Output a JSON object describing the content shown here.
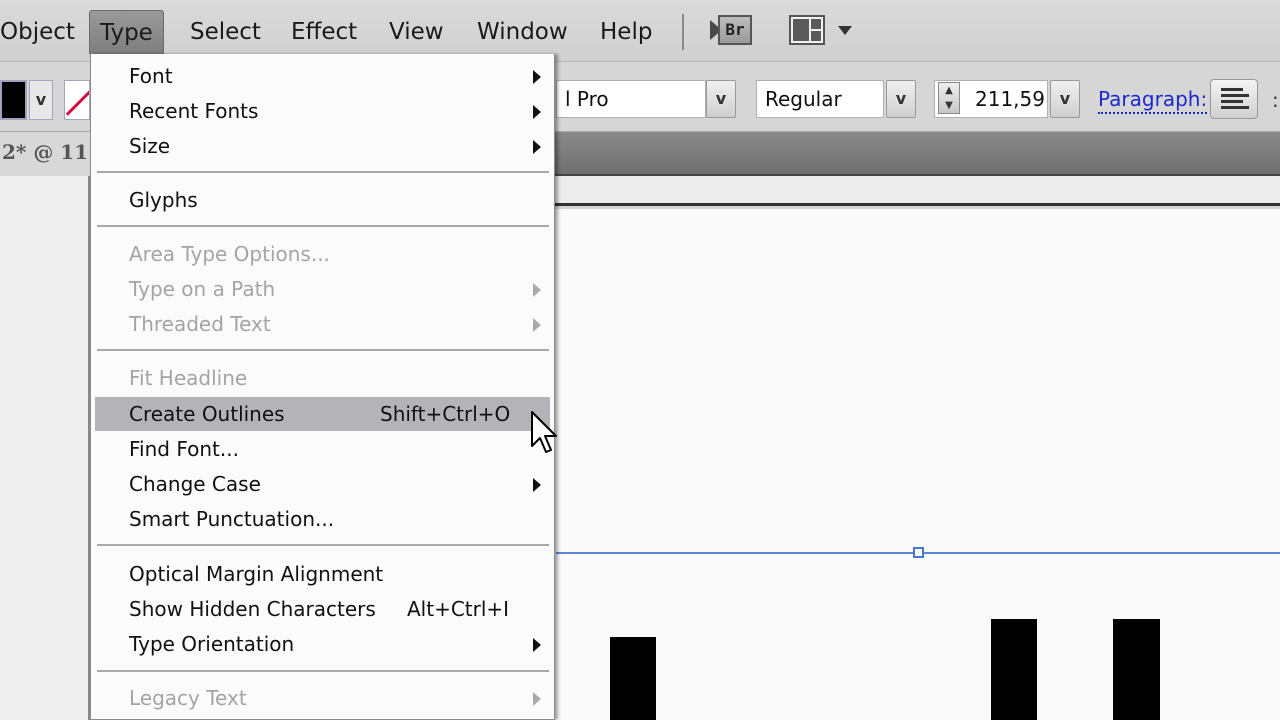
{
  "menubar": {
    "items": [
      {
        "label": "Object"
      },
      {
        "label": "Type",
        "active": true
      },
      {
        "label": "Select"
      },
      {
        "label": "Effect"
      },
      {
        "label": "View"
      },
      {
        "label": "Window"
      },
      {
        "label": "Help"
      }
    ],
    "bridge_icon_label": "Br",
    "icons": [
      "bridge-icon",
      "workspace-switcher-icon",
      "caret-down-icon"
    ]
  },
  "controlbar": {
    "fill_color": "#000000",
    "stroke_color": "none",
    "font_family_value": "l Pro",
    "font_style_value": "Regular",
    "font_size_value": "211,59",
    "paragraph_label": "Paragraph:",
    "chevron": "v"
  },
  "document": {
    "tab_label": "2* @ 11"
  },
  "type_menu": {
    "items": [
      {
        "label": "Font",
        "submenu": true,
        "enabled": true
      },
      {
        "label": "Recent Fonts",
        "submenu": true,
        "enabled": true
      },
      {
        "label": "Size",
        "submenu": true,
        "enabled": true
      },
      {
        "separator": true
      },
      {
        "label": "Glyphs",
        "enabled": true
      },
      {
        "separator": true
      },
      {
        "label": "Area Type Options...",
        "enabled": false
      },
      {
        "label": "Type on a Path",
        "submenu": true,
        "enabled": false
      },
      {
        "label": "Threaded Text",
        "submenu": true,
        "enabled": false
      },
      {
        "separator": true
      },
      {
        "label": "Fit Headline",
        "enabled": false
      },
      {
        "label": "Create Outlines",
        "shortcut": "Shift+Ctrl+O",
        "enabled": true,
        "highlighted": true
      },
      {
        "label": "Find Font...",
        "enabled": true
      },
      {
        "label": "Change Case",
        "submenu": true,
        "enabled": true
      },
      {
        "label": "Smart Punctuation...",
        "enabled": true
      },
      {
        "separator": true
      },
      {
        "label": "Optical Margin Alignment",
        "enabled": true
      },
      {
        "label": "Show Hidden Characters",
        "shortcut": "Alt+Ctrl+I",
        "enabled": true
      },
      {
        "label": "Type Orientation",
        "submenu": true,
        "enabled": true
      },
      {
        "separator": true
      },
      {
        "label": "Legacy Text",
        "submenu": true,
        "enabled": false
      }
    ]
  },
  "canvas": {
    "guide_color": "#5b86d6"
  }
}
